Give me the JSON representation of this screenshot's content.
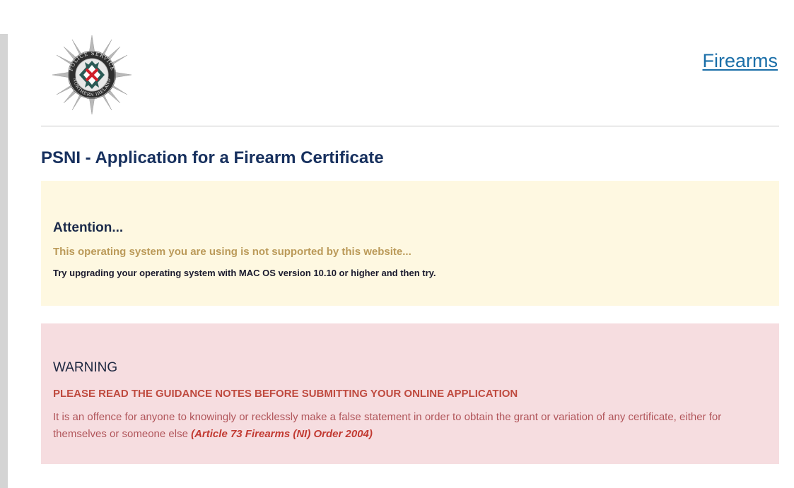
{
  "header": {
    "logo_name": "psni-crest-logo",
    "logo_text_top": "POLICE SERVICE",
    "logo_text_bottom": "NORTHERN IRELAND",
    "nav_link": "Firearms"
  },
  "page": {
    "title": "PSNI - Application for a Firearm Certificate"
  },
  "attention": {
    "heading": "Attention...",
    "message": "This operating system you are using is not supported by this website...",
    "hint": "Try upgrading your operating system with MAC OS version 10.10 or higher and then try."
  },
  "warning": {
    "heading": "WARNING",
    "notice": "PLEASE READ THE GUIDANCE NOTES BEFORE SUBMITTING YOUR ONLINE APPLICATION",
    "body": "It is an offence for anyone to knowingly or recklessly make a false statement in order to obtain the grant or variation of any certificate, either for themselves or someone else ",
    "legal_reference": "(Article 73 Firearms (NI) Order 2004)"
  },
  "colors": {
    "title_navy": "#17305e",
    "link_blue": "#1a6ea8",
    "attention_bg": "#fef8e1",
    "attention_text": "#bb9a59",
    "warning_bg": "#f6dde0",
    "warning_text": "#bf4a3f"
  }
}
